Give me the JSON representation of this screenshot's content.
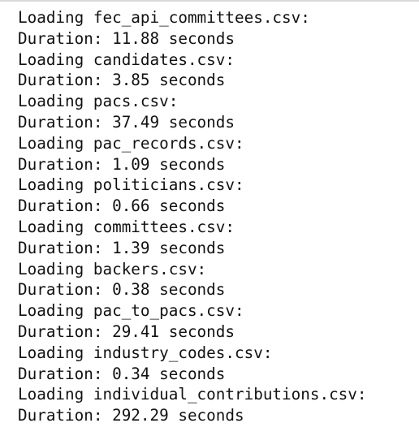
{
  "output": {
    "lines": [
      "Loading fec_api_committees.csv:",
      "Duration: 11.88 seconds",
      "Loading candidates.csv:",
      "Duration: 3.85 seconds",
      "Loading pacs.csv:",
      "Duration: 37.49 seconds",
      "Loading pac_records.csv:",
      "Duration: 1.09 seconds",
      "Loading politicians.csv:",
      "Duration: 0.66 seconds",
      "Loading committees.csv:",
      "Duration: 1.39 seconds",
      "Loading backers.csv:",
      "Duration: 0.38 seconds",
      "Loading pac_to_pacs.csv:",
      "Duration: 29.41 seconds",
      "Loading industry_codes.csv:",
      "Duration: 0.34 seconds",
      "Loading individual_contributions.csv:",
      "Duration: 292.29 seconds"
    ]
  }
}
